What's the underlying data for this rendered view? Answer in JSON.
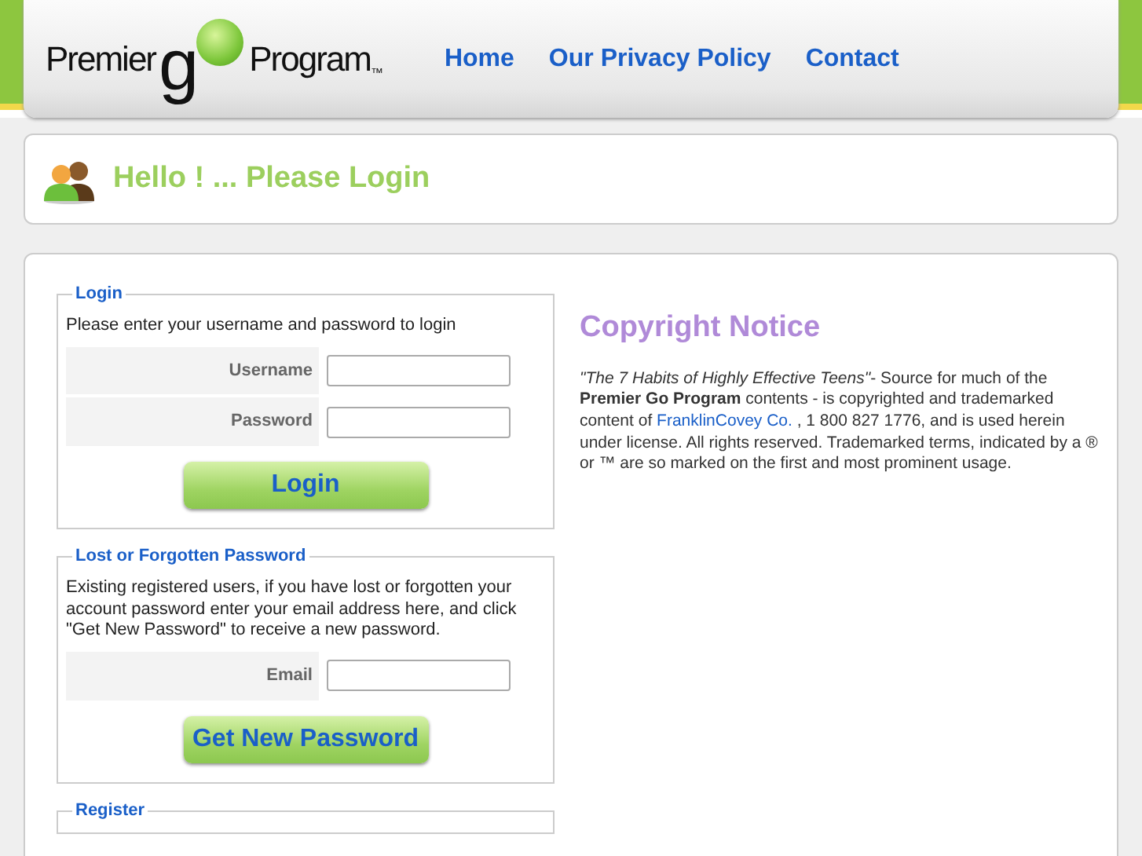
{
  "logo": {
    "left": "Premier",
    "g": "g",
    "right": "Program",
    "tm": "™"
  },
  "nav": [
    {
      "label": "Home"
    },
    {
      "label": "Our Privacy Policy"
    },
    {
      "label": "Contact"
    }
  ],
  "greeting": "Hello ! ... Please Login",
  "login": {
    "legend": "Login",
    "intro": "Please enter your username and password to login",
    "fields": [
      {
        "label": "Username"
      },
      {
        "label": "Password"
      }
    ],
    "button": "Login"
  },
  "lost": {
    "legend": "Lost or Forgotten Password",
    "intro": "Existing registered users, if you have lost or forgotten your account password enter your email address here, and click \"Get New Password\" to receive a new password.",
    "fields": [
      {
        "label": "Email"
      }
    ],
    "button": "Get New Password"
  },
  "register": {
    "legend": "Register"
  },
  "copyright": {
    "title": "Copyright Notice",
    "before": "*\"The 7 Habits of Highly Effective Teens\"*- Source for much of the **Premier Go Program** contents - is copyrighted and trademarked content of ",
    "link": "FranklinCovey Co.",
    "after": " , 1 800 827 1776, and is used herein under license. All rights reserved. Trademarked terms, indicated by a ® or ™ are so marked on the first and most prominent usage."
  }
}
